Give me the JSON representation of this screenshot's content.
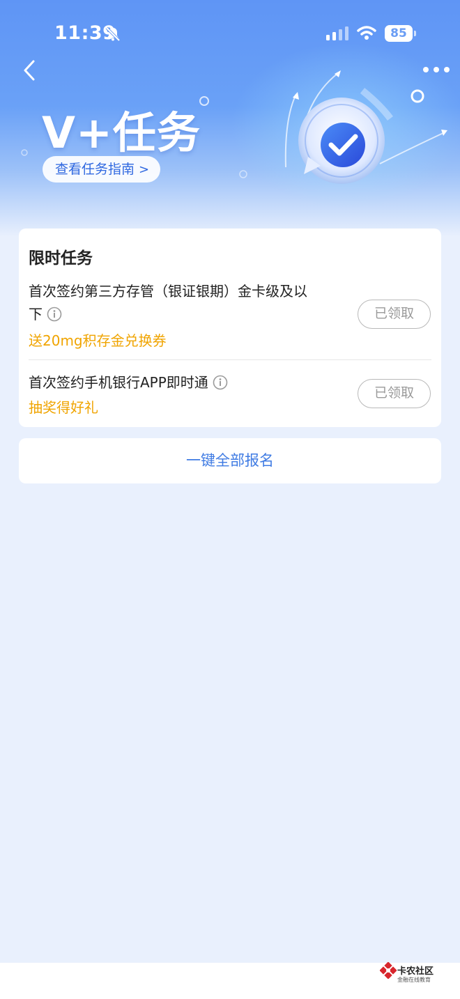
{
  "status_bar": {
    "time": "11:39",
    "battery": "85"
  },
  "hero": {
    "title": "V+任务",
    "guide_label": "查看任务指南"
  },
  "limited_tasks": {
    "title": "限时任务",
    "items": [
      {
        "line1": "首次签约第三方存管（银证银期）金卡级及以",
        "line2": "下",
        "reward": "送20mg积存金兑换券",
        "button": "已领取"
      },
      {
        "line1": "首次签约手机银行APP即时通",
        "reward": "抽奖得好礼",
        "button": "已领取"
      }
    ]
  },
  "signup": {
    "label": "一键全部报名"
  },
  "watermark": {
    "title": "卡农社区",
    "subtitle": "金融在线教育"
  },
  "colors": {
    "accent": "#3f7be3",
    "reward": "#f0a400",
    "hero": "#6aa1f7"
  },
  "icons": [
    "bell-off-icon",
    "signal-icon",
    "wifi-icon",
    "battery-icon",
    "back-arrow-icon",
    "more-icon",
    "info-icon",
    "check-badge-icon",
    "watermark-logo-icon"
  ]
}
